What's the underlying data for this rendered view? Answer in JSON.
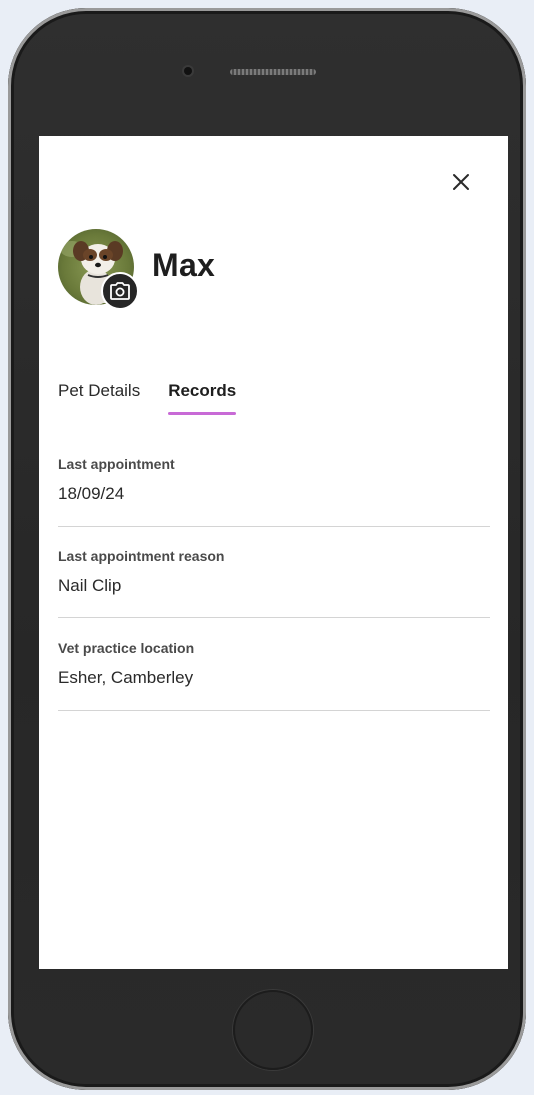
{
  "pet": {
    "name": "Max"
  },
  "tabs": [
    {
      "label": "Pet Details",
      "active": false
    },
    {
      "label": "Records",
      "active": true
    }
  ],
  "records": [
    {
      "label": "Last appointment",
      "value": "18/09/24"
    },
    {
      "label": "Last appointment reason",
      "value": "Nail Clip"
    },
    {
      "label": "Vet practice location",
      "value": "Esher, Camberley"
    }
  ],
  "icons": {
    "close": "close-icon",
    "camera": "camera-icon"
  },
  "colors": {
    "accent": "#c86ad6",
    "camera_button": "#262626"
  }
}
